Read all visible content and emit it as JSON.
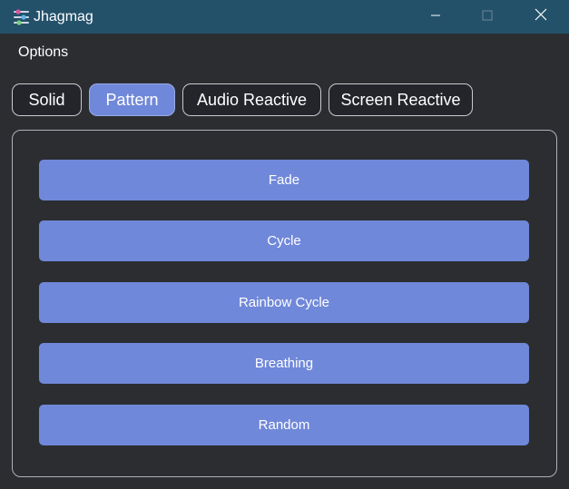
{
  "window": {
    "title": "Jhagmag"
  },
  "menu": {
    "options_label": "Options"
  },
  "tabs": [
    {
      "label": "Solid"
    },
    {
      "label": "Pattern"
    },
    {
      "label": "Audio Reactive"
    },
    {
      "label": "Screen Reactive"
    }
  ],
  "active_tab": "Pattern",
  "patterns": [
    {
      "label": "Fade"
    },
    {
      "label": "Cycle"
    },
    {
      "label": "Rainbow Cycle"
    },
    {
      "label": "Breathing"
    },
    {
      "label": "Random"
    }
  ],
  "colors": {
    "titlebar": "#23516a",
    "background": "#2b2d31",
    "accent": "#7088d9"
  },
  "icons": {
    "app": "sliders-icon",
    "minimize": "minimize-icon",
    "maximize": "maximize-icon",
    "close": "close-icon"
  }
}
